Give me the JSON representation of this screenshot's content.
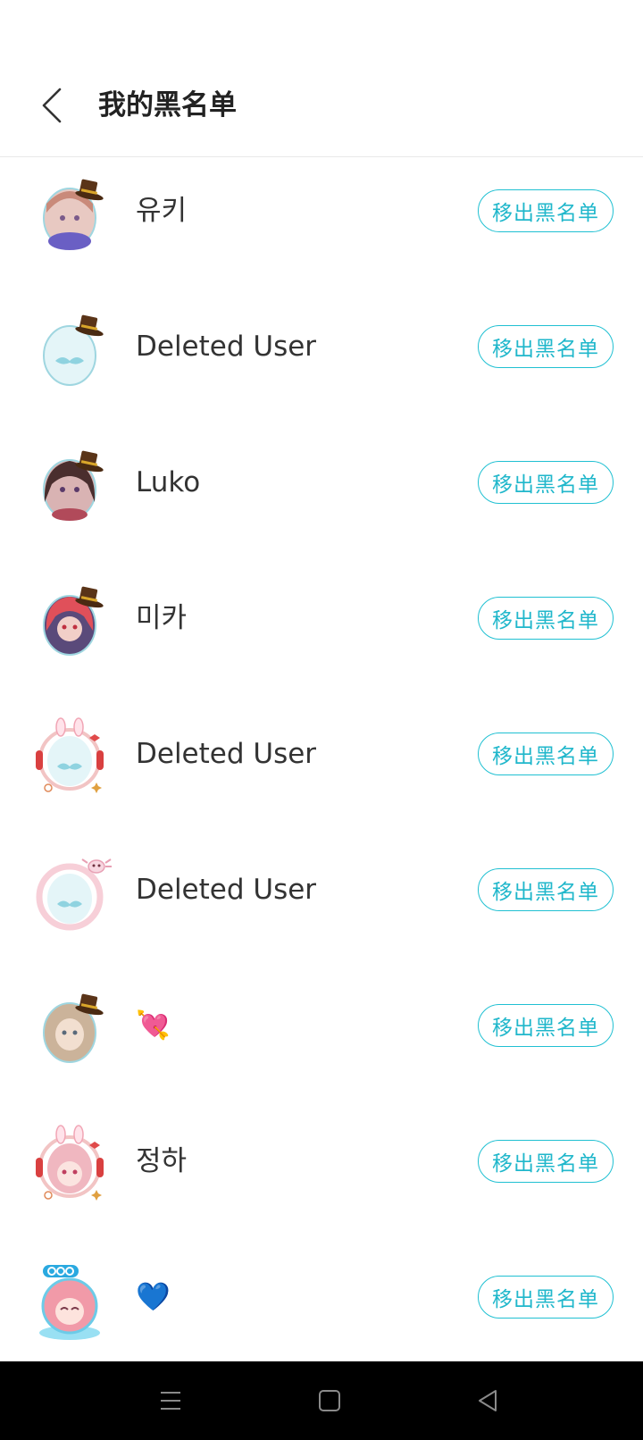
{
  "header": {
    "title": "我的黑名单",
    "back_icon": "chevron-left-icon"
  },
  "colors": {
    "accent": "#20b7cb",
    "text": "#333333",
    "nav_bar": "#000000"
  },
  "blacklist": [
    {
      "name": "유키",
      "avatar_icon": "anime-girl-top-hat-avatar",
      "button_label": "移出黑名单"
    },
    {
      "name": "Deleted User",
      "avatar_icon": "mustache-egg-top-hat-avatar",
      "button_label": "移出黑名单"
    },
    {
      "name": "Luko",
      "avatar_icon": "anime-girl-top-hat-avatar",
      "button_label": "移出黑名单"
    },
    {
      "name": "미카",
      "avatar_icon": "anime-girl-top-hat-avatar",
      "button_label": "移出黑名单"
    },
    {
      "name": "Deleted User",
      "avatar_icon": "mustache-egg-bunny-frame-avatar",
      "button_label": "移出黑名单"
    },
    {
      "name": "Deleted User",
      "avatar_icon": "mustache-egg-pink-frame-avatar",
      "button_label": "移出黑名单"
    },
    {
      "name": "💘",
      "avatar_icon": "anime-girl-top-hat-avatar",
      "button_label": "移出黑名单"
    },
    {
      "name": "정하",
      "avatar_icon": "anime-girl-bunny-frame-avatar",
      "button_label": "移出黑名单"
    },
    {
      "name": "💙",
      "avatar_icon": "anime-girl-qoo-frame-avatar",
      "button_label": "移出黑名单"
    }
  ],
  "nav": {
    "menu_icon": "menu-icon",
    "home_icon": "home-square-icon",
    "back_icon": "back-triangle-icon"
  }
}
